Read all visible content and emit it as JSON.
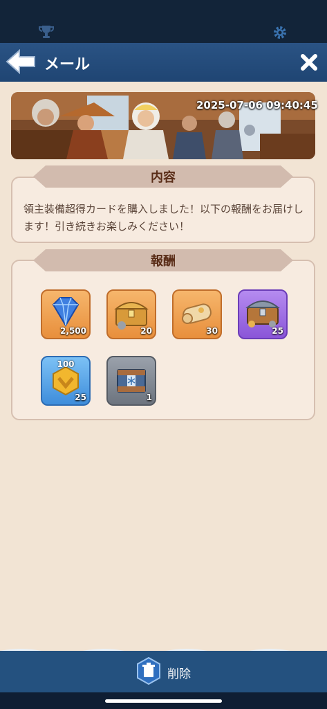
{
  "header": {
    "title": "メール"
  },
  "mail": {
    "timestamp": "2025-07-06 09:40:45",
    "content_heading": "内容",
    "message": "領主装備超得カードを購入しました！以下の報酬をお届けします！引き続きお楽しみください！",
    "rewards_heading": "報酬"
  },
  "rewards": [
    {
      "icon": "blue-gem-icon",
      "count": "2,500",
      "frame": "orange"
    },
    {
      "icon": "gold-treasure-chest-icon",
      "count": "20",
      "frame": "orange"
    },
    {
      "icon": "scroll-icon",
      "count": "30",
      "frame": "orange"
    },
    {
      "icon": "purple-treasure-chest-icon",
      "count": "25",
      "frame": "purple"
    },
    {
      "icon": "gold-hexagon-token-icon",
      "label": "100",
      "count": "25",
      "frame": "blue"
    },
    {
      "icon": "snowflake-crate-icon",
      "count": "1",
      "frame": "gray"
    }
  ],
  "footer": {
    "delete_label": "削除"
  },
  "colors": {
    "header": "#2a5384",
    "panel": "#f2e4d4",
    "ribbon": "#d2bbae",
    "footer": "#24517f"
  }
}
